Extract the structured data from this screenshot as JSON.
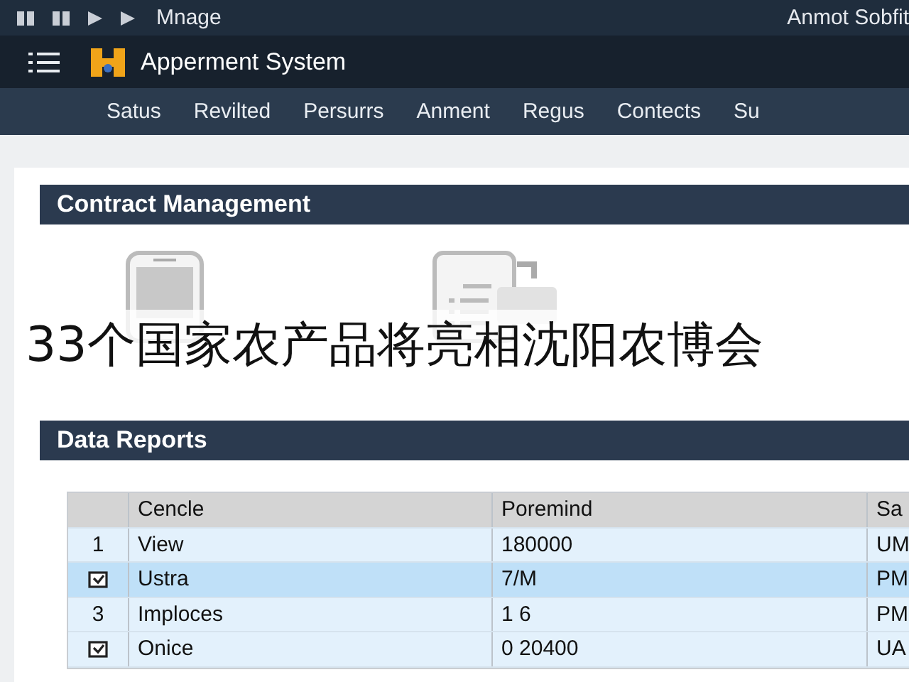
{
  "top_bar": {
    "title": "Mnage",
    "account": "Anmot Sobfit"
  },
  "app_bar": {
    "title": "Apperment System"
  },
  "nav": [
    {
      "label": "Satus"
    },
    {
      "label": "Revilted"
    },
    {
      "label": "Persurrs"
    },
    {
      "label": "Anment"
    },
    {
      "label": "Regus"
    },
    {
      "label": "Contects"
    },
    {
      "label": "Su"
    }
  ],
  "contract_section": {
    "title": "Contract Management"
  },
  "caption": "33个国家农产品将亮相沈阳农博会",
  "reports_section": {
    "title": "Data Reports"
  },
  "table": {
    "columns": [
      "Cencle",
      "Poremind",
      "Sa"
    ],
    "rows": [
      {
        "kind": "number",
        "marker": "1",
        "selected": false,
        "cells": [
          "View",
          "180000",
          "UM"
        ]
      },
      {
        "kind": "check",
        "checked": true,
        "selected": true,
        "cells": [
          "Ustra",
          "7/M",
          "PM"
        ]
      },
      {
        "kind": "number",
        "marker": "3",
        "selected": false,
        "cells": [
          "Imploces",
          "1 6",
          "PM"
        ]
      },
      {
        "kind": "check",
        "checked": true,
        "selected": false,
        "cells": [
          "Onice",
          "0 20400",
          "UA"
        ]
      }
    ]
  }
}
